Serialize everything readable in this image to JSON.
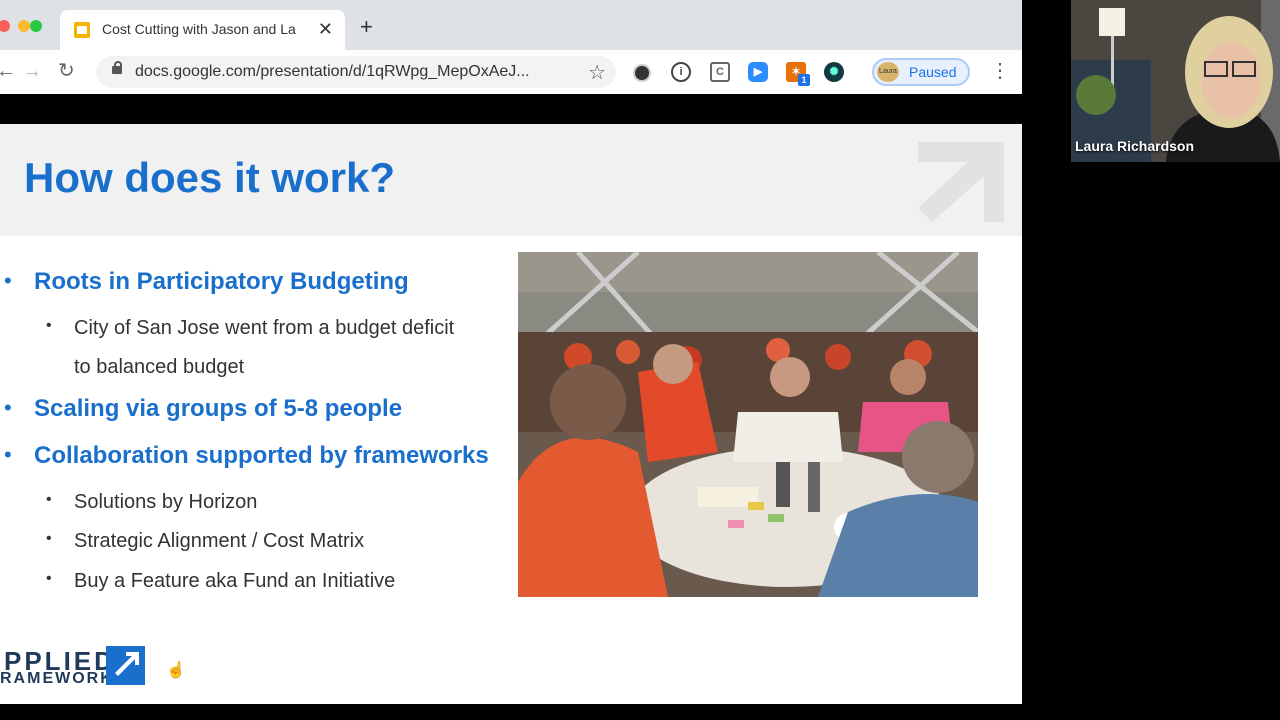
{
  "browser": {
    "tab_title": "Cost Cutting with Jason and La",
    "tab_close": "✕",
    "new_tab": "+",
    "url": "docs.google.com/presentation/d/1qRWpg_MepOxAeJ...",
    "profile_avatar_text": "Laura",
    "profile_status": "Paused",
    "extension_badge": "1"
  },
  "slide": {
    "title": "How does it work?",
    "bullets": [
      {
        "text": "Roots in Participatory Budgeting",
        "level": 1
      },
      {
        "text": "City of San Jose went from a budget deficit",
        "level": 2
      },
      {
        "text": "to balanced budget",
        "level": 2
      },
      {
        "text": "Scaling via groups of 5-8 people",
        "level": 1
      },
      {
        "text": "Collaboration supported by frameworks",
        "level": 1
      },
      {
        "text": "Solutions by Horizon",
        "level": 2
      },
      {
        "text": "Strategic Alignment / Cost Matrix",
        "level": 2
      },
      {
        "text": "Buy a Feature aka Fund an Initiative",
        "level": 2
      }
    ],
    "logo_line1": "PPLIED",
    "logo_line2": "RAMEWORKS"
  },
  "video": {
    "participant_name": "Laura Richardson"
  },
  "colors": {
    "accent_blue": "#1a6fcc",
    "chrome_bg": "#dee1e6",
    "profile_blue": "#1a73e8"
  }
}
